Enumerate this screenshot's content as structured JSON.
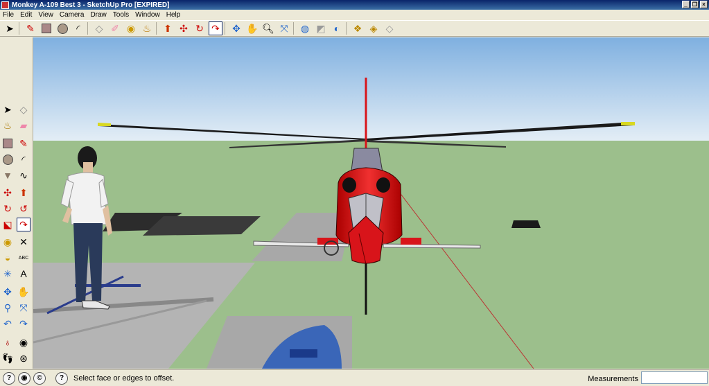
{
  "window": {
    "title": "Monkey A-109 Best 3 - SketchUp Pro [EXPIRED]"
  },
  "menu": [
    "File",
    "Edit",
    "View",
    "Camera",
    "Draw",
    "Tools",
    "Window",
    "Help"
  ],
  "toolbar_icons": [
    "select-icon",
    "pencil-icon",
    "rectangle-icon",
    "circle-icon",
    "arc-icon",
    "eraser-icon",
    "paint-icon",
    "tape-measure-icon",
    "paint-bucket-icon",
    "push-pull-icon",
    "move-icon",
    "rotate-icon",
    "offset-icon",
    "orbit-icon",
    "pan-icon",
    "zoom-icon",
    "zoom-extents-icon",
    "get-models-icon",
    "share-model-icon",
    "warehouse-icon",
    "component-icon",
    "add-location-icon",
    "preview-icon"
  ],
  "status": {
    "text": "Select face or edges to offset.",
    "measurements_label": "Measurements",
    "measurements_value": ""
  },
  "colors": {
    "sky_top": "#7fb0e0",
    "sky_bottom": "#e4eef6",
    "ground": "#9cbf8c",
    "heli_red": "#d8141a"
  }
}
